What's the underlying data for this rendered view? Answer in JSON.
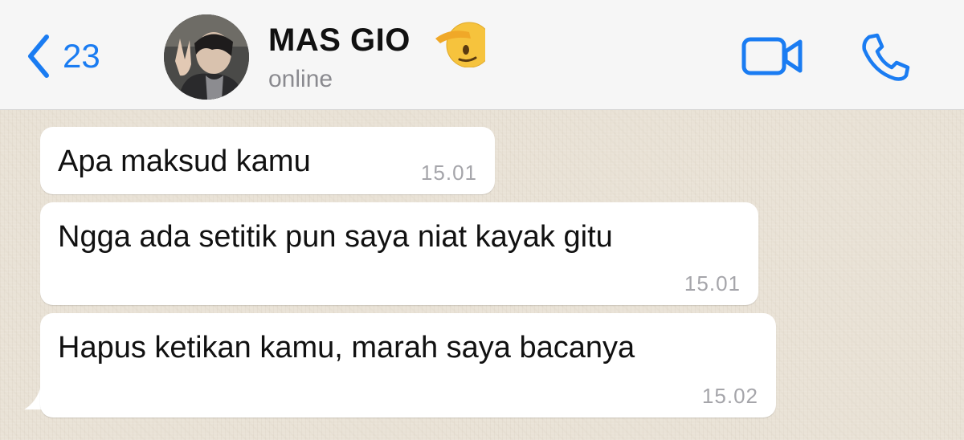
{
  "header": {
    "back_count": "23",
    "contact_name": "MAS GIO",
    "status": "online",
    "avatar_icon": "avatar-photo",
    "name_emoji_icon": "saluting-face-emoji",
    "video_icon": "video-camera-icon",
    "call_icon": "phone-icon"
  },
  "messages": [
    {
      "text": "Apa maksud kamu",
      "time": "15.01"
    },
    {
      "text": "Ngga ada setitik pun saya niat kayak gitu",
      "time": "15.01"
    },
    {
      "text": "Hapus ketikan kamu, marah saya bacanya",
      "time": "15.02"
    }
  ],
  "colors": {
    "accent": "#1a7cf2",
    "header_bg": "#f6f6f6",
    "chat_bg": "#e9e2d6",
    "bubble_bg": "#ffffff",
    "timestamp": "#a5a5aa"
  }
}
